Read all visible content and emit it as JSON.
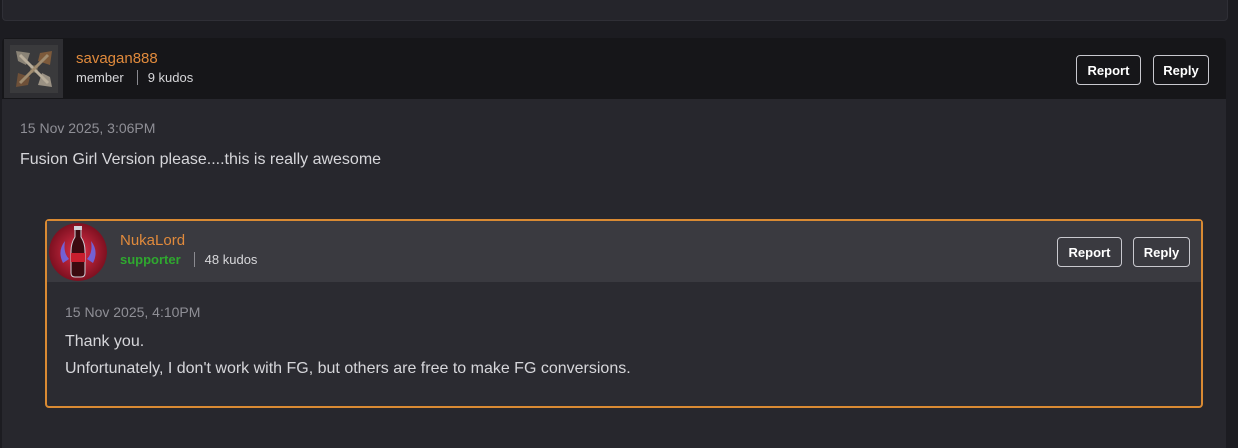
{
  "comment": {
    "username": "savagan888",
    "role": "member",
    "kudos": "9 kudos",
    "date": "15 Nov 2025, 3:06PM",
    "body": "Fusion Girl Version please....this is really awesome",
    "report_label": "Report",
    "reply_label": "Reply",
    "avatar_icon": "broken-blocks-icon"
  },
  "reply": {
    "username": "NukaLord",
    "role": "supporter",
    "kudos": "48 kudos",
    "date": "15 Nov 2025, 4:10PM",
    "body_lines": [
      "Thank you.",
      "Unfortunately, I don't work with FG, but others are free to make FG conversions."
    ],
    "report_label": "Report",
    "reply_label": "Reply",
    "avatar_icon": "nuka-cola-bottle-icon"
  },
  "colors": {
    "username": "#e08a3c",
    "supporter": "#2fa82f",
    "highlight_border": "#d98a33"
  }
}
